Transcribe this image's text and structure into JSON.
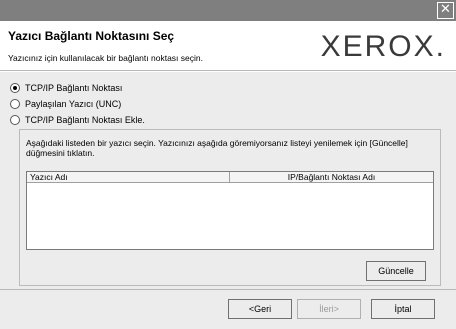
{
  "window": {
    "close_glyph": "✕"
  },
  "header": {
    "title": "Yazıcı Bağlantı Noktasını Seç",
    "subtitle": "Yazıcınız için kullanılacak bir bağlantı noktası seçin.",
    "logo": "XEROX."
  },
  "options": [
    {
      "label": "TCP/IP Bağlantı Noktası",
      "selected": true
    },
    {
      "label": "Paylaşılan Yazıcı (UNC)",
      "selected": false
    },
    {
      "label": "TCP/IP Bağlantı Noktası Ekle.",
      "selected": false
    }
  ],
  "group": {
    "instruction": "Aşağıdaki listeden bir yazıcı seçin. Yazıcınızı aşağıda göremiyorsanız listeyi yenilemek için [Güncelle] düğmesini tıklatın.",
    "columns": [
      "Yazıcı Adı",
      "IP/Bağlantı Noktası Adı"
    ],
    "refresh_label": "Güncelle"
  },
  "footer": {
    "back_label": "<Geri",
    "next_label": "İleri>",
    "cancel_label": "İptal"
  }
}
